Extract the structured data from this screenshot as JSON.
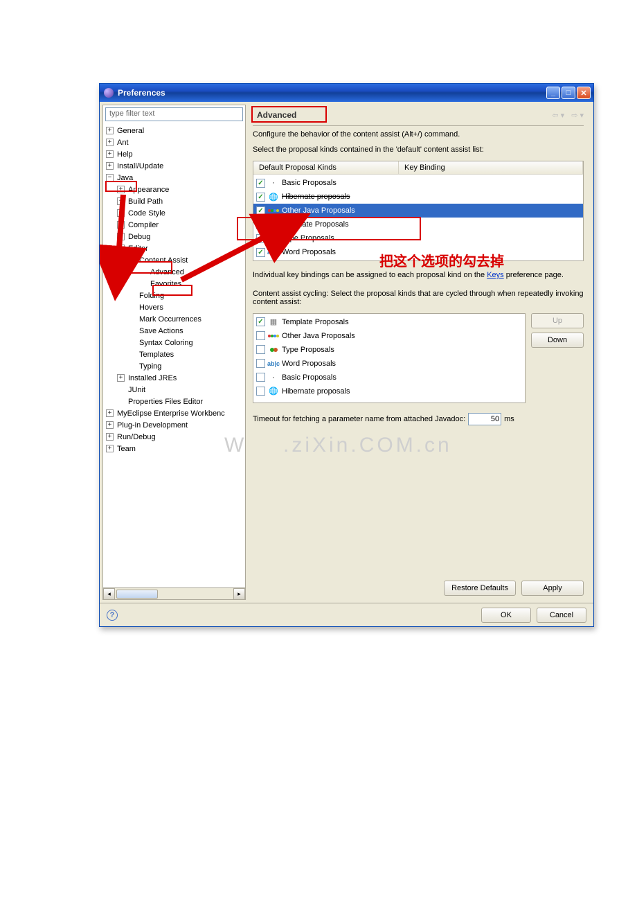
{
  "title": "Preferences",
  "filter_placeholder": "type filter text",
  "tree": {
    "general": "General",
    "ant": "Ant",
    "help": "Help",
    "install": "Install/Update",
    "java": "Java",
    "appearance": "Appearance",
    "buildpath": "Build Path",
    "codestyle": "Code Style",
    "compiler": "Compiler",
    "debug": "Debug",
    "editor": "Editor",
    "contentassist": "Content Assist",
    "advanced": "Advanced",
    "favorites": "Favorites",
    "folding": "Folding",
    "hovers": "Hovers",
    "mark": "Mark Occurrences",
    "save": "Save Actions",
    "syntax": "Syntax Coloring",
    "templates": "Templates",
    "typing": "Typing",
    "installedjres": "Installed JREs",
    "junit": "JUnit",
    "propfiles": "Properties Files Editor",
    "myeclipse": "MyEclipse Enterprise Workbenc",
    "plugindev": "Plug-in Development",
    "rundebug": "Run/Debug",
    "team": "Team"
  },
  "page_title": "Advanced",
  "intro": "Configure the behavior of the content assist (Alt+/) command.",
  "select_label": "Select the proposal kinds contained in the 'default' content assist list:",
  "col1": "Default Proposal Kinds",
  "col2": "Key Binding",
  "kinds": {
    "basic": "Basic Proposals",
    "hibernate": "Hibernate proposals",
    "otherjava": "Other Java Proposals",
    "template": "Template Proposals",
    "type": "Type Proposals",
    "word": "Word Proposals"
  },
  "individual": "Individual key bindings can be assigned to each proposal kind on the ",
  "keys_link": "Keys",
  "individual2": " preference page.",
  "cycling": "Content assist cycling: Select the proposal kinds that are cycled through when repeatedly invoking content assist:",
  "up": "Up",
  "down": "Down",
  "timeout_label": "Timeout for fetching a parameter name from attached Javadoc:",
  "timeout_value": "50",
  "ms": "ms",
  "restore": "Restore Defaults",
  "apply": "Apply",
  "ok": "OK",
  "cancel": "Cancel",
  "annotation": "把这个选项的勾去掉",
  "watermark1": "W",
  "watermark2": ".ziXin.COM.cn"
}
